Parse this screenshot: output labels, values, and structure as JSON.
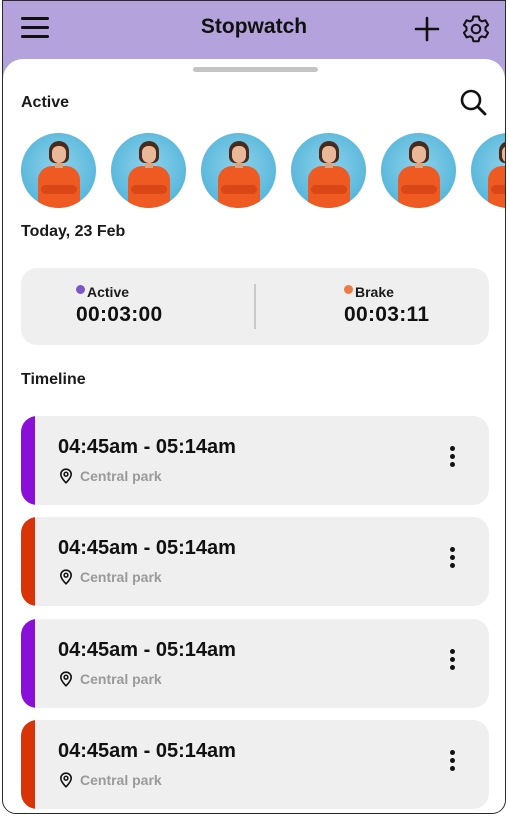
{
  "header": {
    "title": "Stopwatch",
    "menu_icon": "hamburger-menu-icon",
    "add_icon": "plus-icon",
    "settings_icon": "gear-icon",
    "background": "#b4a2dd"
  },
  "active": {
    "label": "Active",
    "search_icon": "search-icon",
    "avatars": [
      "person-1",
      "person-2",
      "person-3",
      "person-4",
      "person-5",
      "person-6"
    ]
  },
  "date_label": "Today, 23 Feb",
  "summary": {
    "active": {
      "label": "Active",
      "value": "00:03:00",
      "color": "#7b57c7"
    },
    "brake": {
      "label": "Brake",
      "value": "00:03:11",
      "color": "#ee7a45"
    }
  },
  "timeline": {
    "label": "Timeline",
    "entries": [
      {
        "range": "04:45am - 05:14am",
        "location": "Central park",
        "color": "#8a0fd8"
      },
      {
        "range": "04:45am - 05:14am",
        "location": "Central park",
        "color": "#d83408"
      },
      {
        "range": "04:45am - 05:14am",
        "location": "Central park",
        "color": "#8a0fd8"
      },
      {
        "range": "04:45am - 05:14am",
        "location": "Central park",
        "color": "#d83408"
      }
    ]
  }
}
